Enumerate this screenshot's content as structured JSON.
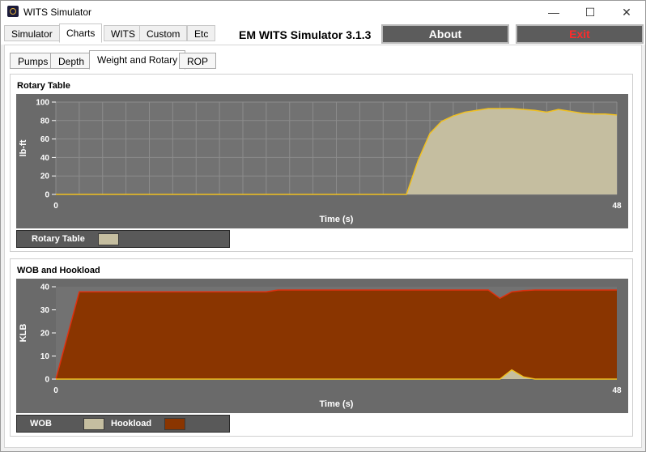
{
  "window": {
    "title": "WITS Simulator",
    "controls": [
      "—",
      "☐",
      "✕"
    ]
  },
  "top_tabs": [
    {
      "label": "Simulator",
      "active": false
    },
    {
      "label": "Charts",
      "active": true
    },
    {
      "label": "WITS",
      "active": false
    },
    {
      "label": "Custom",
      "active": false
    },
    {
      "label": "Etc",
      "active": false
    }
  ],
  "app_title": "EM WITS Simulator 3.1.3",
  "buttons": {
    "about": "About",
    "exit": "Exit"
  },
  "sub_tabs": [
    {
      "label": "Pumps",
      "active": false
    },
    {
      "label": "Depth",
      "active": false
    },
    {
      "label": "Weight and Rotary",
      "active": true
    },
    {
      "label": "ROP",
      "active": false
    }
  ],
  "colors": {
    "chart_bg": "#6a6a6a",
    "grid": "#8c8c8c",
    "rotary_fill": "#c5bea0",
    "rotary_line": "#f0c020",
    "hookload_fill": "#8a3500",
    "hookload_line": "#e03010",
    "wob_fill": "#c5bea0",
    "wob_line": "#f0c020"
  },
  "chart_data": [
    {
      "type": "area",
      "title": "Rotary Table",
      "xlabel": "Time (s)",
      "ylabel": "lb-ft",
      "xlim": [
        0,
        48
      ],
      "ylim": [
        0,
        100
      ],
      "x_ticks": [
        0,
        48
      ],
      "y_ticks": [
        0,
        20,
        40,
        60,
        80,
        100
      ],
      "grid": true,
      "legend": "bottom-left",
      "series": [
        {
          "name": "Rotary Table",
          "x": [
            0,
            30,
            31,
            32,
            33,
            34,
            35,
            36,
            37,
            38,
            39,
            40,
            41,
            42,
            43,
            44,
            45,
            46,
            47,
            48
          ],
          "values": [
            0,
            0,
            37,
            66,
            79,
            85,
            89,
            91,
            93,
            93,
            93,
            92,
            91,
            89,
            92,
            90,
            88,
            87,
            87,
            86
          ]
        }
      ]
    },
    {
      "type": "area",
      "title": "WOB and Hookload",
      "xlabel": "Time (s)",
      "ylabel": "KLB",
      "xlim": [
        0,
        48
      ],
      "ylim": [
        0,
        40
      ],
      "x_ticks": [
        0,
        48
      ],
      "y_ticks": [
        0,
        10,
        20,
        30,
        40
      ],
      "grid": false,
      "legend": "bottom-left",
      "series": [
        {
          "name": "WOB",
          "x": [
            0,
            37,
            38,
            39,
            40,
            41,
            42,
            48
          ],
          "values": [
            0,
            0,
            0,
            4,
            1,
            0,
            0,
            0
          ]
        },
        {
          "name": "Hookload",
          "x": [
            0,
            2,
            18,
            19,
            20,
            37,
            38,
            39,
            40,
            41,
            48
          ],
          "values": [
            0,
            37.8,
            37.8,
            38.6,
            38.6,
            38.6,
            35,
            37.8,
            38.3,
            38.6,
            38.6
          ]
        }
      ]
    }
  ]
}
